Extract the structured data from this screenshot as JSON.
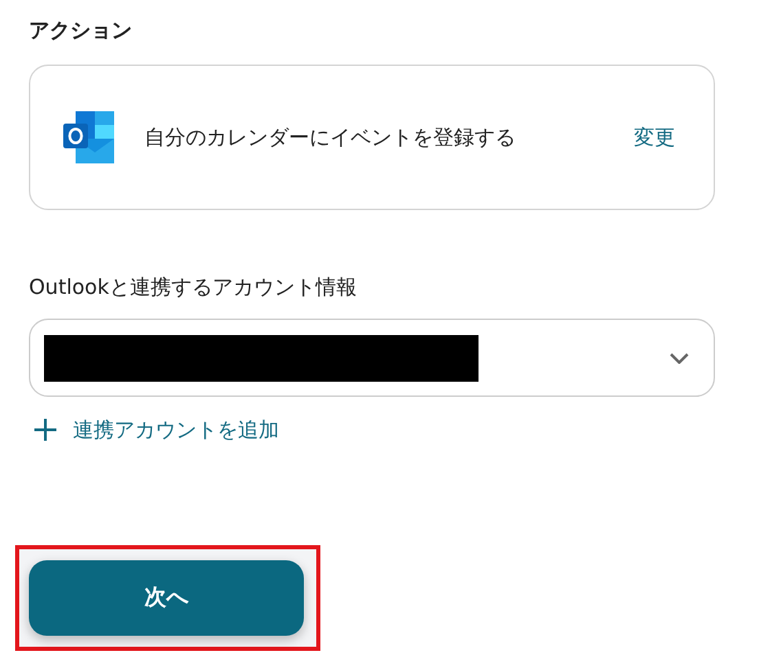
{
  "action_section": {
    "heading": "アクション",
    "action": {
      "label": "自分のカレンダーにイベントを登録する",
      "change_link": "変更"
    }
  },
  "account_section": {
    "label": "Outlookと連携するアカウント情報",
    "select": {
      "value_redacted": true
    },
    "add_link": "連携アカウントを追加"
  },
  "next_button": {
    "label": "次へ",
    "highlighted": true
  }
}
